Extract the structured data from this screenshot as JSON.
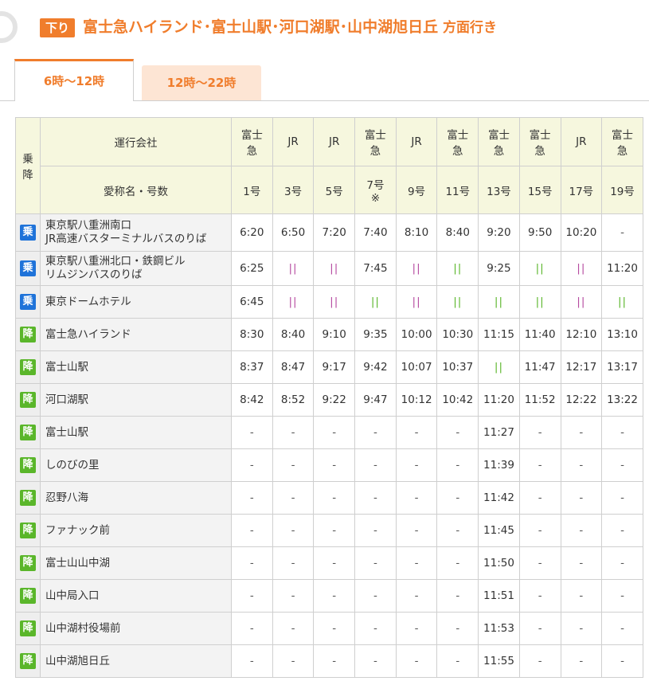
{
  "header": {
    "badge": "下り",
    "title": "富士急ハイランド･富士山駅･河口湖駅･山中湖旭日丘",
    "title_suffix": " 方面行き"
  },
  "tabs": [
    {
      "label": "6時～12時",
      "active": true
    },
    {
      "label": "12時～22時",
      "active": false
    }
  ],
  "table": {
    "head_board_alight": "乗\n降",
    "head_operator": "運行会社",
    "head_name": "愛称名・号数",
    "operators": [
      "富士\n急",
      "JR",
      "JR",
      "富士\n急",
      "JR",
      "富士\n急",
      "富士\n急",
      "富士\n急",
      "JR",
      "富士\n急"
    ],
    "numbers": [
      "1号",
      "3号",
      "5号",
      "7号\n※",
      "9号",
      "11号",
      "13号",
      "15号",
      "17号",
      "19号"
    ],
    "rows": [
      {
        "type": "乗",
        "stop": "東京駅八重洲南口\nJR高速バスターミナルバスのりば",
        "times": [
          "6:20",
          "6:50",
          "7:20",
          "7:40",
          "8:10",
          "8:40",
          "9:20",
          "9:50",
          "10:20",
          "-"
        ]
      },
      {
        "type": "乗",
        "stop": "東京駅八重洲北口・鉄鋼ビル\nリムジンバスのりば",
        "times": [
          "6:25",
          "||",
          "||",
          "7:45",
          "||",
          "||",
          "9:25",
          "||",
          "||",
          "11:20"
        ]
      },
      {
        "type": "乗",
        "stop": "東京ドームホテル",
        "times": [
          "6:45",
          "||",
          "||",
          "||",
          "||",
          "||",
          "||",
          "||",
          "||",
          "||"
        ]
      },
      {
        "type": "降",
        "stop": "富士急ハイランド",
        "times": [
          "8:30",
          "8:40",
          "9:10",
          "9:35",
          "10:00",
          "10:30",
          "11:15",
          "11:40",
          "12:10",
          "13:10"
        ]
      },
      {
        "type": "降",
        "stop": "富士山駅",
        "times": [
          "8:37",
          "8:47",
          "9:17",
          "9:42",
          "10:07",
          "10:37",
          "||",
          "11:47",
          "12:17",
          "13:17"
        ]
      },
      {
        "type": "降",
        "stop": "河口湖駅",
        "times": [
          "8:42",
          "8:52",
          "9:22",
          "9:47",
          "10:12",
          "10:42",
          "11:20",
          "11:52",
          "12:22",
          "13:22"
        ]
      },
      {
        "type": "降",
        "stop": "富士山駅",
        "times": [
          "-",
          "-",
          "-",
          "-",
          "-",
          "-",
          "11:27",
          "-",
          "-",
          "-"
        ]
      },
      {
        "type": "降",
        "stop": "しのびの里",
        "times": [
          "-",
          "-",
          "-",
          "-",
          "-",
          "-",
          "11:39",
          "-",
          "-",
          "-"
        ]
      },
      {
        "type": "降",
        "stop": "忍野八海",
        "times": [
          "-",
          "-",
          "-",
          "-",
          "-",
          "-",
          "11:42",
          "-",
          "-",
          "-"
        ]
      },
      {
        "type": "降",
        "stop": "ファナック前",
        "times": [
          "-",
          "-",
          "-",
          "-",
          "-",
          "-",
          "11:45",
          "-",
          "-",
          "-"
        ]
      },
      {
        "type": "降",
        "stop": "富士山山中湖",
        "times": [
          "-",
          "-",
          "-",
          "-",
          "-",
          "-",
          "11:50",
          "-",
          "-",
          "-"
        ]
      },
      {
        "type": "降",
        "stop": "山中局入口",
        "times": [
          "-",
          "-",
          "-",
          "-",
          "-",
          "-",
          "11:51",
          "-",
          "-",
          "-"
        ]
      },
      {
        "type": "降",
        "stop": "山中湖村役場前",
        "times": [
          "-",
          "-",
          "-",
          "-",
          "-",
          "-",
          "11:53",
          "-",
          "-",
          "-"
        ]
      },
      {
        "type": "降",
        "stop": "山中湖旭日丘",
        "times": [
          "-",
          "-",
          "-",
          "-",
          "-",
          "-",
          "11:55",
          "-",
          "-",
          "-"
        ]
      }
    ]
  },
  "colors": {
    "accent": "#f07d2c",
    "board": "#1f73d9",
    "alight": "#5ab62a",
    "header_bg": "#f6f7de",
    "jr_bar": "#b64aa0"
  }
}
